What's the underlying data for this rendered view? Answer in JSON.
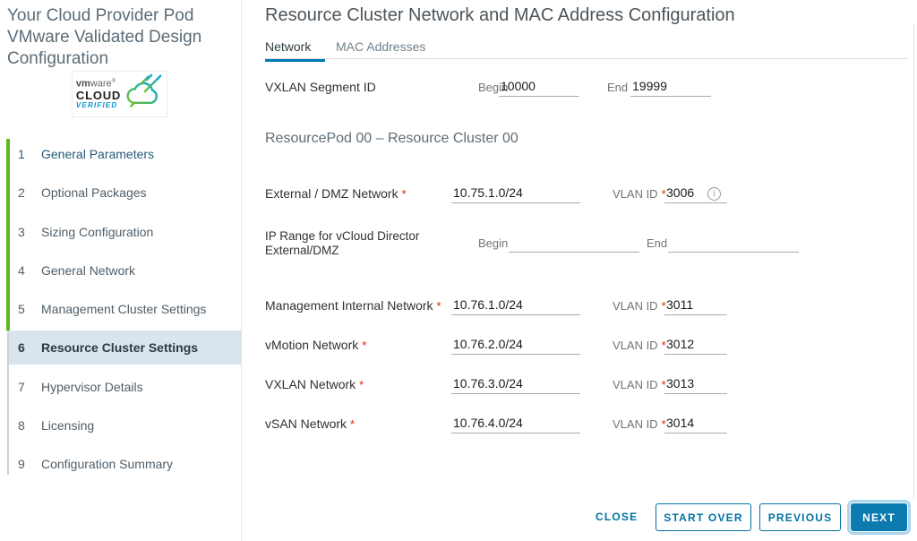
{
  "sidebar": {
    "title": "Your Cloud Provider Pod VMware Validated Design Configuration",
    "logo": {
      "brand_bold": "vm",
      "brand_rest": "ware",
      "registered": "®",
      "cloud_word": "CLOUD",
      "verified_word": "VERIFIED"
    },
    "steps": [
      {
        "num": "1",
        "label": "General Parameters"
      },
      {
        "num": "2",
        "label": "Optional Packages"
      },
      {
        "num": "3",
        "label": "Sizing Configuration"
      },
      {
        "num": "4",
        "label": "General Network"
      },
      {
        "num": "5",
        "label": "Management Cluster Settings"
      },
      {
        "num": "6",
        "label": "Resource Cluster Settings"
      },
      {
        "num": "7",
        "label": "Hypervisor Details"
      },
      {
        "num": "8",
        "label": "Licensing"
      },
      {
        "num": "9",
        "label": "Configuration Summary"
      }
    ]
  },
  "main": {
    "title": "Resource Cluster Network and MAC Address Configuration",
    "tabs": [
      {
        "label": "Network",
        "active": true
      },
      {
        "label": "MAC Addresses",
        "active": false
      }
    ],
    "required_marker": "*",
    "vxlan_segment": {
      "label": "VXLAN Segment ID",
      "begin_label": "Begin",
      "begin_value": "10000",
      "end_label": "End",
      "end_value": "19999"
    },
    "section_title": "ResourcePod 00 – Resource Cluster 00",
    "external_row": {
      "label": "External / DMZ Network",
      "value": "10.75.1.0/24",
      "vlan_label": "VLAN ID",
      "vlan_value": "3006",
      "info_glyph": "i"
    },
    "ip_range_row": {
      "label_line1": "IP Range for vCloud Director",
      "label_line2": "External/DMZ",
      "begin_label": "Begin",
      "begin_value": "",
      "end_label": "End",
      "end_value": ""
    },
    "network_rows": [
      {
        "label": "Management Internal Network",
        "value": "10.76.1.0/24",
        "vlan_label": "VLAN ID",
        "vlan_value": "3011"
      },
      {
        "label": "vMotion Network",
        "value": "10.76.2.0/24",
        "vlan_label": "VLAN ID",
        "vlan_value": "3012"
      },
      {
        "label": "VXLAN Network",
        "value": "10.76.3.0/24",
        "vlan_label": "VLAN ID",
        "vlan_value": "3013"
      },
      {
        "label": "vSAN Network",
        "value": "10.76.4.0/24",
        "vlan_label": "VLAN ID",
        "vlan_value": "3014"
      }
    ],
    "footer": {
      "close": "CLOSE",
      "start_over": "START OVER",
      "previous": "PREVIOUS",
      "next": "NEXT"
    }
  },
  "colors": {
    "accent_blue": "#0079b8",
    "button_blue": "#0072a3",
    "progress_green": "#61b715",
    "required_red": "#e12200",
    "active_step_bg": "#d8e5ec"
  }
}
